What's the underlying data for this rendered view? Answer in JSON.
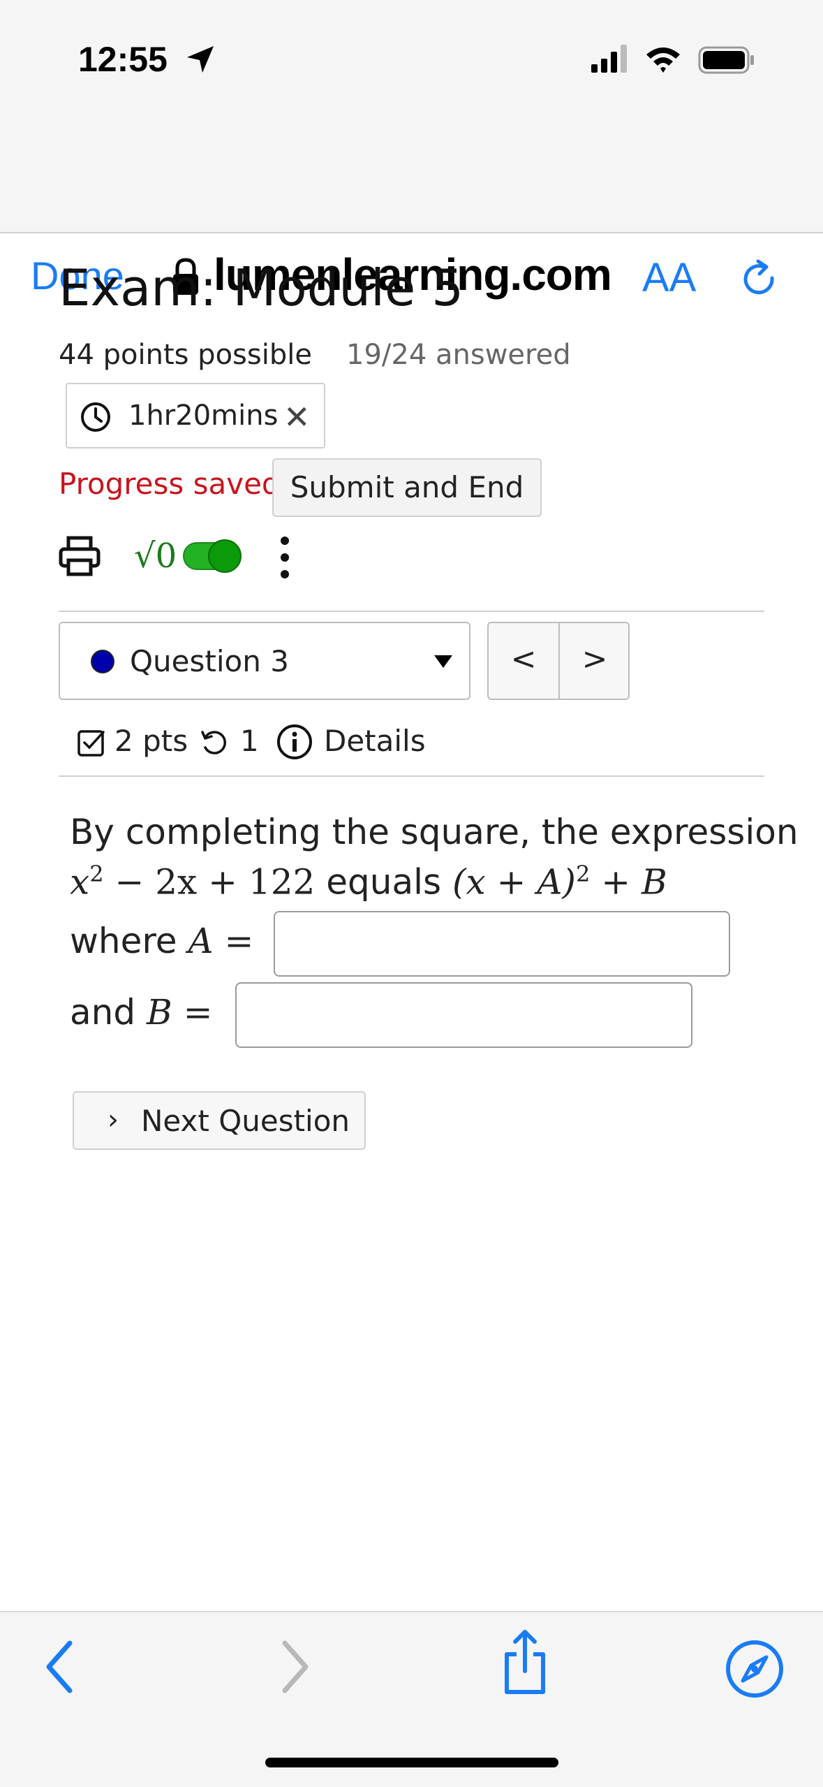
{
  "status_bar": {
    "time": "12:55"
  },
  "browser": {
    "done_label": "Done",
    "domain": "lumenlearning.com",
    "text_size_label": "AA"
  },
  "exam": {
    "title": "Exam: Module 5",
    "points": "44 points possible",
    "answered": "19/24 answered",
    "timer": "1hr20mins",
    "progress_status": "Progress saved",
    "submit_label": "Submit and End"
  },
  "question_nav": {
    "selected": "Question 3",
    "prev_label": "<",
    "next_label": ">"
  },
  "question_meta": {
    "points": "2 pts",
    "attempts": "1",
    "details_label": "Details"
  },
  "question": {
    "line1": "By completing the square, the expression",
    "expr_a": "x",
    "expr_a_exp": "2",
    "expr_b": " − 2x + 122",
    "equals_word": " equals ",
    "expr_c": "(x + A)",
    "expr_c_exp": "2",
    "expr_d": " + B",
    "where_word": "where ",
    "var_a": "A",
    "and_word": "and ",
    "var_b": "B",
    "eq_sign": " ="
  },
  "answers": {
    "A": "",
    "B": ""
  },
  "next_question_label": "Next Question",
  "colors": {
    "accent": "#1a7cf5",
    "alert": "#c8141e",
    "toggle": "#23b223"
  }
}
